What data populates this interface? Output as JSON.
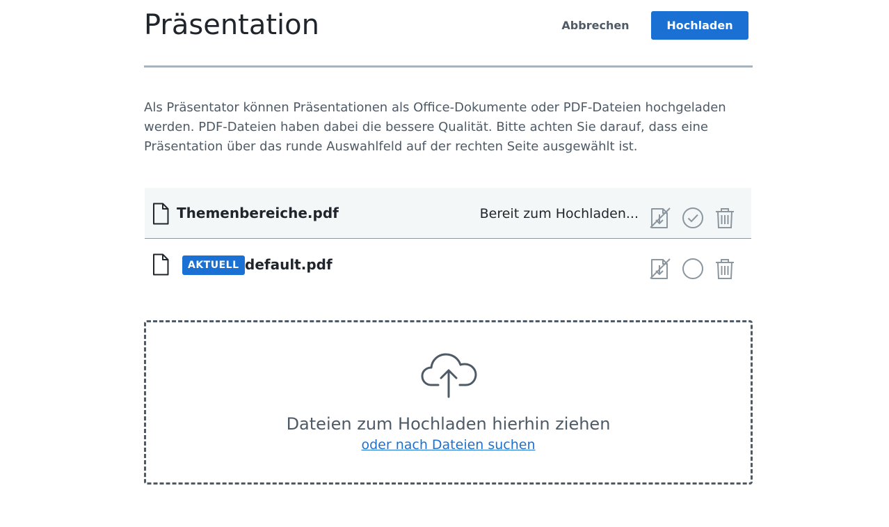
{
  "header": {
    "title": "Präsentation",
    "cancel_label": "Abbrechen",
    "upload_label": "Hochladen"
  },
  "description": "Als Präsentator können Präsentationen als Office-Dokumente oder PDF-Dateien hochgeladen werden. PDF-Dateien haben dabei die bessere Qualität. Bitte achten Sie darauf, dass eine Präsentation über das runde Auswahlfeld auf der rechten Seite ausgewählt ist.",
  "files": [
    {
      "name": "Themenbereiche.pdf",
      "status": "Bereit zum Hochladen...",
      "selected": true,
      "icon": "file-icon"
    },
    {
      "name": "default.pdf",
      "badge": "AKTUELL",
      "selected": false,
      "icon": "file-icon"
    }
  ],
  "dropzone": {
    "title": "Dateien zum Hochladen hierhin ziehen",
    "link": "oder nach Dateien suchen",
    "icon": "cloud-upload-icon"
  },
  "colors": {
    "accent": "#1b71d3",
    "text_muted": "#4e5a66",
    "row_highlight": "#f3f7f7",
    "divider": "#a7b3bd"
  }
}
